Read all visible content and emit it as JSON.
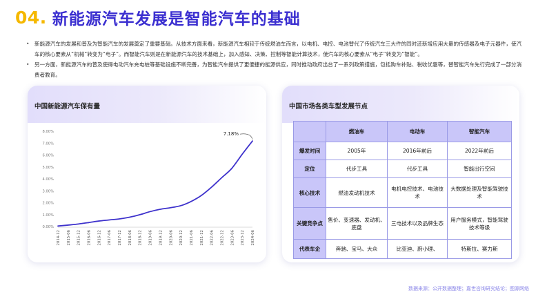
{
  "header": {
    "number": "04.",
    "title": "新能源汽车发展是智能汽车的基础"
  },
  "bullets": [
    "新能源汽车的发展和普及为智能汽车的发展奠定了重要基础。从技术方面来看，新能源汽车相较于传统燃油车而言，以电机、电控、电池替代了传统汽车三大件的同时还新增应用大量的传感器及电子元器件，使汽车的核心要素从“机械”转变为“电子”。而智能汽车则是在新能源汽车的技术基础上，加入感知、决策、控制等智能计算技术，使汽车的核心要素从“电子”转变为“智能”。",
    "另一方面，新能源汽车的普及使得电动汽车充电桩等基础设施不断完善，为智能汽车提供了更便捷的能源供应，同时推动政府出台了一系列政策措施，包括购车补贴、税收优惠等，替智能汽车先行完成了一部分消费者教育。"
  ],
  "left_card": {
    "title": "中国新能源汽车保有量"
  },
  "right_card": {
    "title": "中国市场各类车型发展节点"
  },
  "chart_data": {
    "type": "line",
    "title": "中国新能源汽车保有量",
    "x": [
      "2014-12",
      "2015-06",
      "2015-12",
      "2016-06",
      "2016-12",
      "2017-06",
      "2017-12",
      "2018-06",
      "2018-12",
      "2019-06",
      "2019-12",
      "2020-06",
      "2020-12",
      "2021-06",
      "2021-12",
      "2022-06",
      "2022-12",
      "2023-06",
      "2023-12",
      "2024-06"
    ],
    "series": [
      {
        "values": [
          0.04,
          0.12,
          0.21,
          0.33,
          0.46,
          0.55,
          0.64,
          0.78,
          0.99,
          1.25,
          1.45,
          1.58,
          1.75,
          2.1,
          2.6,
          3.3,
          4.1,
          4.9,
          6.07,
          7.18
        ]
      }
    ],
    "yticks": [
      "0.00%",
      "1.00%",
      "2.00%",
      "3.00%",
      "4.00%",
      "5.00%",
      "6.00%",
      "7.00%",
      "8.00%"
    ],
    "ylim": [
      0,
      8
    ],
    "annotation": {
      "label": "7.18%",
      "x": "2024-06",
      "y": 7.18
    },
    "grid": false,
    "line_color": "#3e32cc"
  },
  "table": {
    "columns": [
      "",
      "燃油车",
      "电动车",
      "智能汽车"
    ],
    "rows": [
      {
        "label": "爆发时间",
        "cells": [
          "2005年",
          "2016年前后",
          "2022年前后"
        ]
      },
      {
        "label": "定位",
        "cells": [
          "代步工具",
          "代步工具",
          "智能出行空间"
        ]
      },
      {
        "label": "核心技术",
        "cells": [
          "燃油发动机技术",
          "电机电控技术、电池技术",
          "大数据处理及智能驾驶技术"
        ]
      },
      {
        "label": "关键竞争点",
        "cells": [
          "售价、变速器、发动机、底盘",
          "三电技术以及品牌生态",
          "用户服务模式，智能驾驶技术等级"
        ]
      },
      {
        "label": "代表车企",
        "cells": [
          "奔驰、宝马、大众",
          "比亚迪、蔚小理、",
          "特斯拉、赛力斯"
        ]
      }
    ]
  },
  "source": "数据来源：公开数据整理；嘉世咨询研究结论；图源网络",
  "colors": {
    "accent_yellow": "#f5b800",
    "accent_blue": "#3b2fd0",
    "table_header": "#c9c6f9",
    "table_border": "#9a9ae6"
  }
}
